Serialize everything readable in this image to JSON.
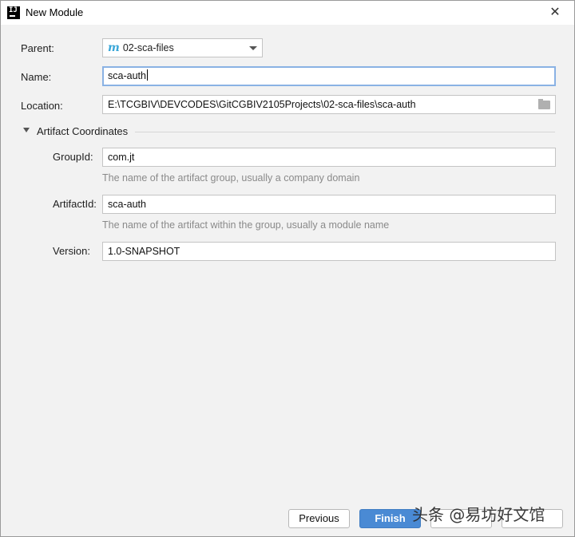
{
  "window": {
    "title": "New Module",
    "app_icon": "intellij-icon",
    "close_icon": "close-icon"
  },
  "form": {
    "parent_label": "Parent:",
    "parent_value": "02-sca-files",
    "parent_icon_glyph": "m",
    "name_label": "Name:",
    "name_value": "sca-auth",
    "location_label": "Location:",
    "location_value": "E:\\TCGBIV\\DEVCODES\\GitCGBIV2105Projects\\02-sca-files\\sca-auth"
  },
  "artifact": {
    "section_title": "Artifact Coordinates",
    "groupid_label": "GroupId:",
    "groupid_value": "com.jt",
    "groupid_hint": "The name of the artifact group, usually a company domain",
    "artifactid_label": "ArtifactId:",
    "artifactid_value": "sca-auth",
    "artifactid_hint": "The name of the artifact within the group, usually a module name",
    "version_label": "Version:",
    "version_value": "1.0-SNAPSHOT"
  },
  "buttons": {
    "previous": "Previous",
    "finish": "Finish"
  },
  "watermark": "头条 @易坊好文馆",
  "colors": {
    "primary_button": "#4a8ad4",
    "focus_border": "#8ab2e4",
    "maven_icon": "#3aa7d8"
  }
}
